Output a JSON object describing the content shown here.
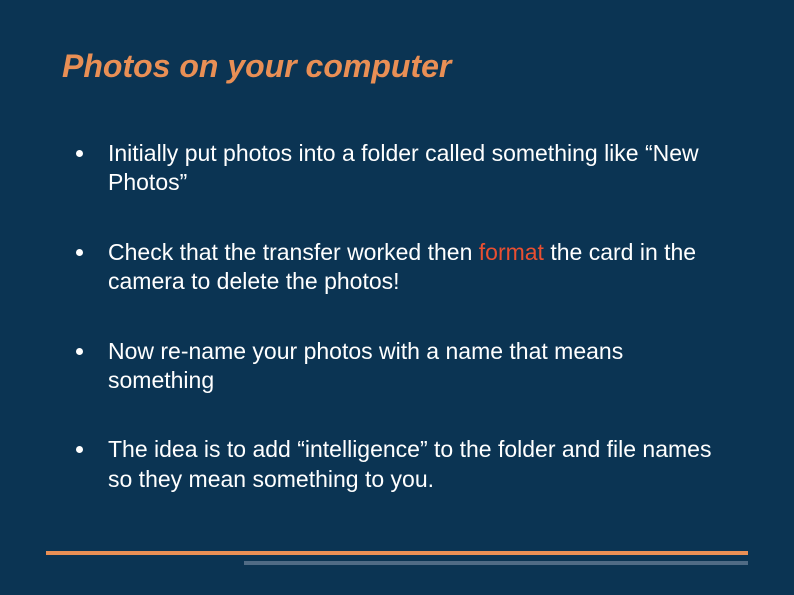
{
  "title": "Photos on your computer",
  "bullets": {
    "b0": "Initially put photos into a folder called something like “New Photos”",
    "b1_pre": "Check that the transfer worked then ",
    "b1_hl": "format",
    "b1_post": " the card in the camera to delete the photos!",
    "b2": "Now re-name your photos with a name that means something",
    "b3": "The idea is to add “intelligence” to the folder and file names so they mean something to you."
  }
}
